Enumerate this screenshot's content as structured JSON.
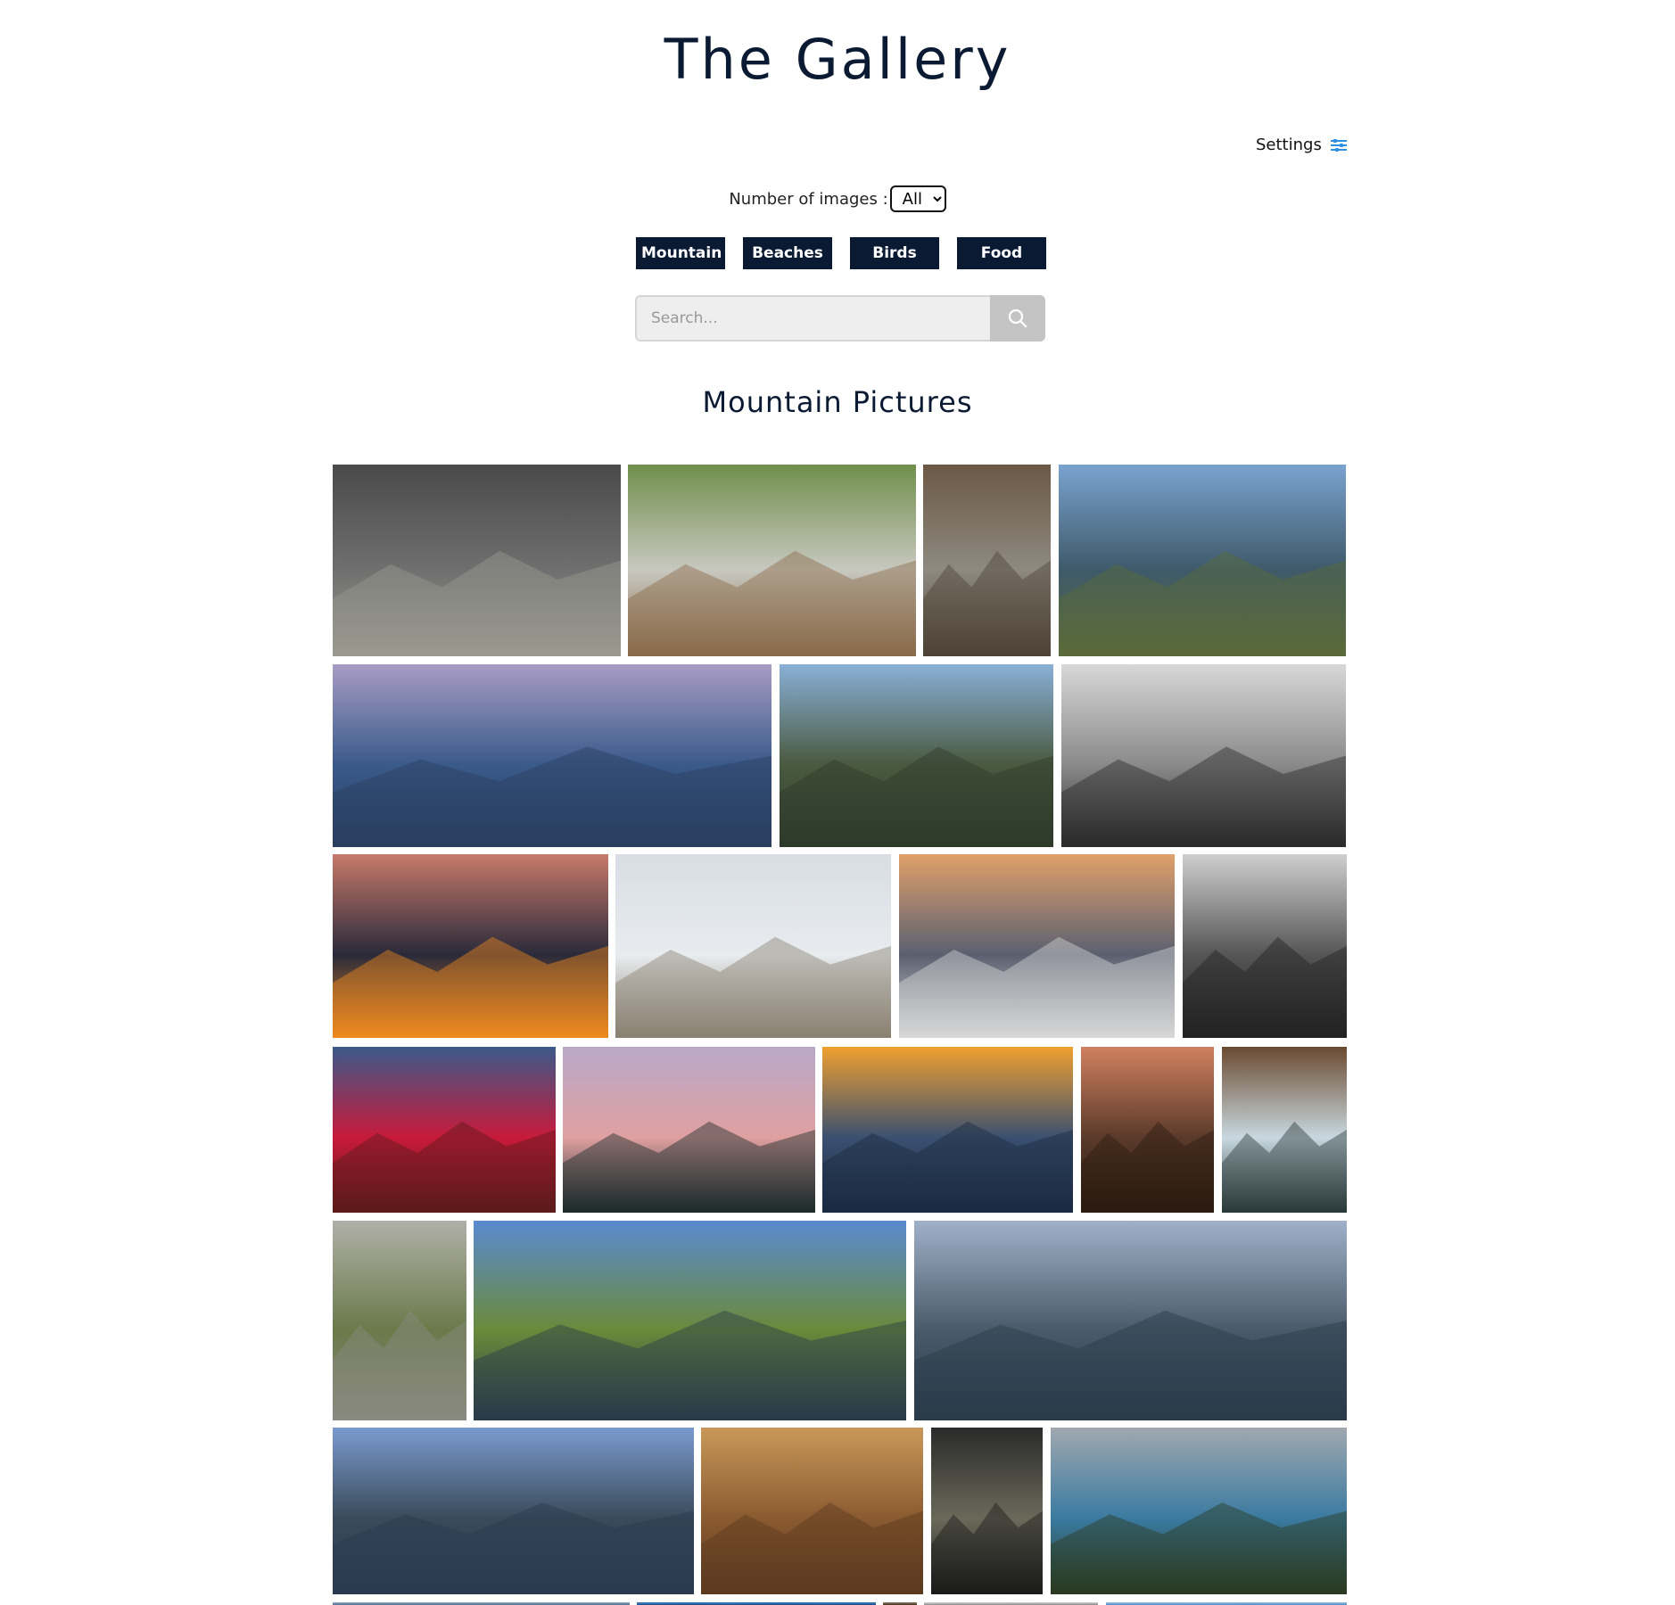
{
  "header": {
    "title": "The Gallery"
  },
  "settings": {
    "label": "Settings",
    "icon": "sliders-icon"
  },
  "controls": {
    "number_of_images_label": "Number of images :",
    "number_of_images_selected": "All"
  },
  "categories": [
    "Mountain",
    "Beaches",
    "Birds",
    "Food"
  ],
  "search": {
    "placeholder": "Search..."
  },
  "section": {
    "title": "Mountain Pictures"
  },
  "gallery": {
    "photos": [
      {
        "name": "stone-tunnel-forest",
        "colors": [
          "#4a4a4a",
          "#6f6f6f",
          "#9a9a90"
        ]
      },
      {
        "name": "mossy-rock",
        "colors": [
          "#6f8f4a",
          "#c8c8c0",
          "#8a6a4a"
        ]
      },
      {
        "name": "tree-stump-leaves",
        "colors": [
          "#6b5845",
          "#8e8a80",
          "#4d4236"
        ]
      },
      {
        "name": "valley-lake-view",
        "colors": [
          "#7aa3d0",
          "#3e5a6a",
          "#5a6a3a"
        ]
      },
      {
        "name": "bridge-sunset-sea",
        "colors": [
          "#a89cc4",
          "#3a5a8a",
          "#2a3e60"
        ]
      },
      {
        "name": "mountain-overlook",
        "colors": [
          "#8ab0d8",
          "#4a5a40",
          "#2e3a2a"
        ]
      },
      {
        "name": "bw-coastline",
        "colors": [
          "#d8d8d8",
          "#8a8a8a",
          "#2a2a2a"
        ]
      },
      {
        "name": "orange-sunset-clouds",
        "colors": [
          "#c77a6a",
          "#2a2a3a",
          "#f08a20"
        ]
      },
      {
        "name": "snow-plateau",
        "colors": [
          "#d8dde4",
          "#e8ecef",
          "#8a8070"
        ]
      },
      {
        "name": "snowy-hills-sunset",
        "colors": [
          "#e0a06a",
          "#5a6070",
          "#d8d8d8"
        ]
      },
      {
        "name": "bw-woman-road",
        "colors": [
          "#cfcfcf",
          "#555555",
          "#222222"
        ]
      },
      {
        "name": "red-bushes-fuji",
        "colors": [
          "#3a5a8a",
          "#c81a3a",
          "#5a1a1a"
        ]
      },
      {
        "name": "pink-peak-dusk",
        "colors": [
          "#b8a8c8",
          "#e0a0a0",
          "#1a2a2a"
        ]
      },
      {
        "name": "alps-golden-sky",
        "colors": [
          "#f0a030",
          "#3a5070",
          "#1a2a40"
        ]
      },
      {
        "name": "old-town-sunset",
        "colors": [
          "#d08060",
          "#5a3a2a",
          "#2a1a10"
        ]
      },
      {
        "name": "waterfall-canyon",
        "colors": [
          "#6a4a30",
          "#c8d8e0",
          "#2a3a3a"
        ]
      },
      {
        "name": "rocky-cliff-shrubs",
        "colors": [
          "#b0b0a8",
          "#6a7a4a",
          "#8a8a80"
        ]
      },
      {
        "name": "fjord-peaks",
        "colors": [
          "#5a8ad0",
          "#6a8a3a",
          "#2a3a4a"
        ]
      },
      {
        "name": "lake-cloudy-sky",
        "colors": [
          "#a0b0c8",
          "#4a5a6a",
          "#2a3a4a"
        ]
      },
      {
        "name": "lake-sunlit-clouds",
        "colors": [
          "#7a9ad0",
          "#3a4a5a",
          "#2a3a50"
        ]
      },
      {
        "name": "autumn-forest-bike",
        "colors": [
          "#c8985a",
          "#8a5a30",
          "#5a3a20"
        ]
      },
      {
        "name": "dark-arch-tunnel",
        "colors": [
          "#2a2a2a",
          "#6a6a5a",
          "#1a1a1a"
        ]
      },
      {
        "name": "coastal-vista",
        "colors": [
          "#a0a8b0",
          "#3a7aa0",
          "#2a3a20"
        ]
      },
      {
        "name": "bottom-row-1",
        "colors": [
          "#8aa8c8",
          "#6a8aa8",
          "#5a7890"
        ]
      },
      {
        "name": "bottom-row-2",
        "colors": [
          "#2a6aaa",
          "#3a7ab8",
          "#1a4a80"
        ]
      },
      {
        "name": "bottom-row-3",
        "colors": [
          "#8a7a60",
          "#6a5a40",
          "#4a3a2a"
        ]
      },
      {
        "name": "bottom-row-4",
        "colors": [
          "#d0d0d0",
          "#b0b0b0",
          "#909090"
        ]
      },
      {
        "name": "bottom-row-5",
        "colors": [
          "#8ac0e8",
          "#70a8d8",
          "#5a90c0"
        ]
      }
    ]
  }
}
